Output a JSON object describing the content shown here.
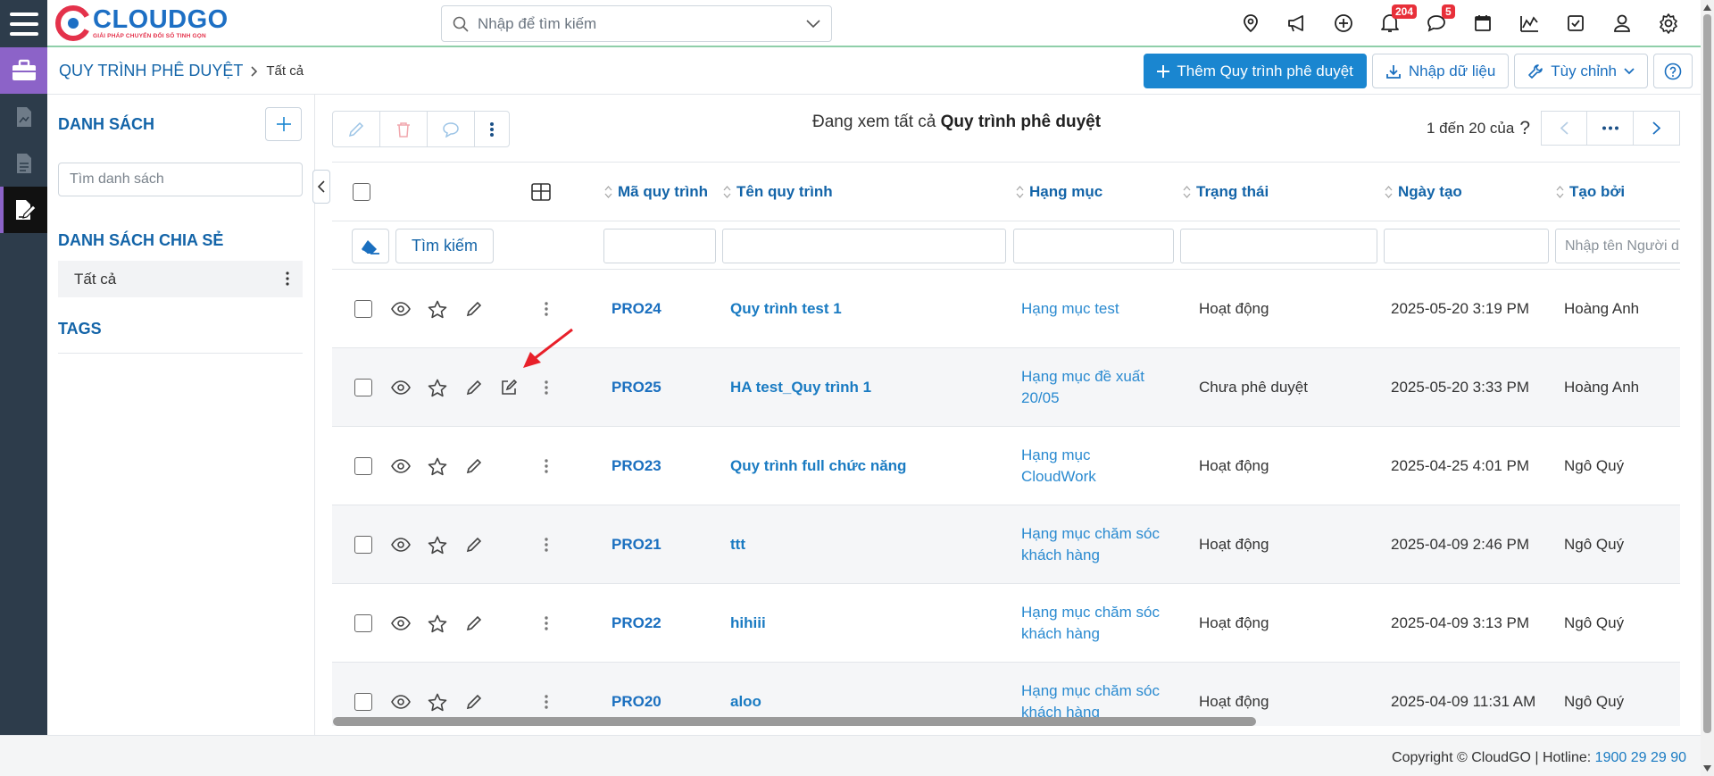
{
  "topbar": {
    "logo_brand": "CLOUDGO",
    "logo_tagline": "GIẢI PHÁP CHUYỂN ĐỔI SỐ TINH GỌN",
    "search_placeholder": "Nhập để tìm kiếm",
    "notifications_badge": "204",
    "messages_badge": "5",
    "icons": [
      "location-icon",
      "megaphone-icon",
      "plus-circle-icon",
      "bell-icon",
      "chat-icon",
      "calendar-icon",
      "chart-icon",
      "checkbox-icon",
      "user-icon",
      "gear-icon"
    ]
  },
  "header": {
    "breadcrumb_main": "QUY TRÌNH PHÊ DUYỆT",
    "breadcrumb_sub": "Tất cả",
    "add_button": "Thêm Quy trình phê duyệt",
    "import_button": "Nhập dữ liệu",
    "customize_button": "Tùy chỉnh"
  },
  "sidebar": {
    "list_heading": "DANH SÁCH",
    "search_placeholder": "Tìm danh sách",
    "shared_heading": "DANH SÁCH CHIA SẺ",
    "all_item": "Tất cả",
    "tags_heading": "TAGS"
  },
  "main": {
    "viewing_prefix": "Đang xem tất cả",
    "viewing_module": "Quy trình phê duyệt",
    "pager_text": "1 đến 20 của",
    "pager_q": "?",
    "search_button": "Tìm kiếm",
    "creator_filter_placeholder": "Nhập tên Người dùng"
  },
  "table": {
    "columns": [
      "Mã quy trình",
      "Tên quy trình",
      "Hạng mục",
      "Trạng thái",
      "Ngày tạo",
      "Tạo bởi"
    ],
    "rows": [
      {
        "code": "PRO24",
        "name": "Quy trình test 1",
        "cat1": "Hạng mục test",
        "cat2": "",
        "status": "Hoạt động",
        "created": "2025-05-20 3:19 PM",
        "creator": "Hoàng Anh"
      },
      {
        "code": "PRO25",
        "name": "HA test_Quy trình 1",
        "cat1": "Hạng mục đề xuất",
        "cat2": "20/05",
        "status": "Chưa phê duyệt",
        "created": "2025-05-20 3:33 PM",
        "creator": "Hoàng Anh"
      },
      {
        "code": "PRO23",
        "name": "Quy trình full chức năng",
        "cat1": "Hạng mục",
        "cat2": "CloudWork",
        "status": "Hoạt động",
        "created": "2025-04-25 4:01 PM",
        "creator": "Ngô Quý"
      },
      {
        "code": "PRO21",
        "name": "ttt",
        "cat1": "Hạng mục chăm sóc",
        "cat2": "khách hàng",
        "status": "Hoạt động",
        "created": "2025-04-09 2:46 PM",
        "creator": "Ngô Quý"
      },
      {
        "code": "PRO22",
        "name": "hihiii",
        "cat1": "Hạng mục chăm sóc",
        "cat2": "khách hàng",
        "status": "Hoạt động",
        "created": "2025-04-09 3:13 PM",
        "creator": "Ngô Quý"
      },
      {
        "code": "PRO20",
        "name": "aloo",
        "cat1": "Hạng mục chăm sóc",
        "cat2": "khách hàng",
        "status": "Hoạt động",
        "created": "2025-04-09 11:31 AM",
        "creator": "Ngô Quý"
      }
    ]
  },
  "footer": {
    "copyright": "Copyright © CloudGO",
    "hotline_label": "| Hotline:",
    "hotline_number": "1900 29 29 90"
  },
  "colors": {
    "primary": "#1a86d0",
    "link": "#1a7bc2",
    "rail": "#2d3c4b",
    "accent_purple": "#8c63c8",
    "badge_red": "#e8303a",
    "arrow_red": "#e8202a"
  }
}
